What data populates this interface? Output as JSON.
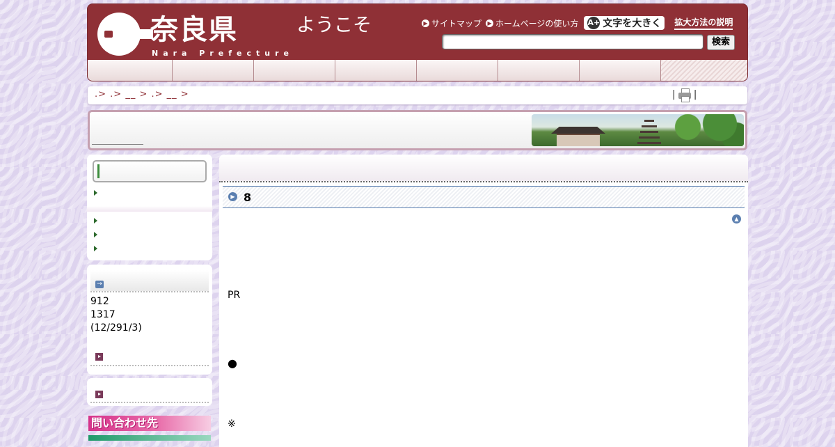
{
  "header": {
    "logo_text": "奈良県",
    "logo_sub": "Nara Prefecture",
    "welcome": "ようこそ",
    "links": {
      "sitemap": "サイトマップ",
      "howto": "ホームページの使い方",
      "bigtext": "文字を大きく",
      "zoom_help": "拡大方法の説明"
    },
    "search_button": "検索",
    "nav_tab_count": 8
  },
  "breadcrumb": {
    "trail": ".> .> __ > .> __ >",
    "print_separator_left": "|",
    "print_separator_right": "|"
  },
  "sidebar": {
    "visits": {
      "line1": "912",
      "line2": "1317",
      "line3": "(12/291/3)"
    },
    "contact_label": "問い合わせ先"
  },
  "main": {
    "section_number": "8",
    "pr_text": "PR",
    "bullet": "●",
    "note_mark": "※"
  },
  "icons": {
    "a_plus": "A+",
    "arrow_right": "→"
  },
  "colors": {
    "header_bg": "#8f3036",
    "page_bg": "#ddd3ee",
    "accent_blue": "#5b7fb0",
    "contact_pink": "#d6338a"
  }
}
